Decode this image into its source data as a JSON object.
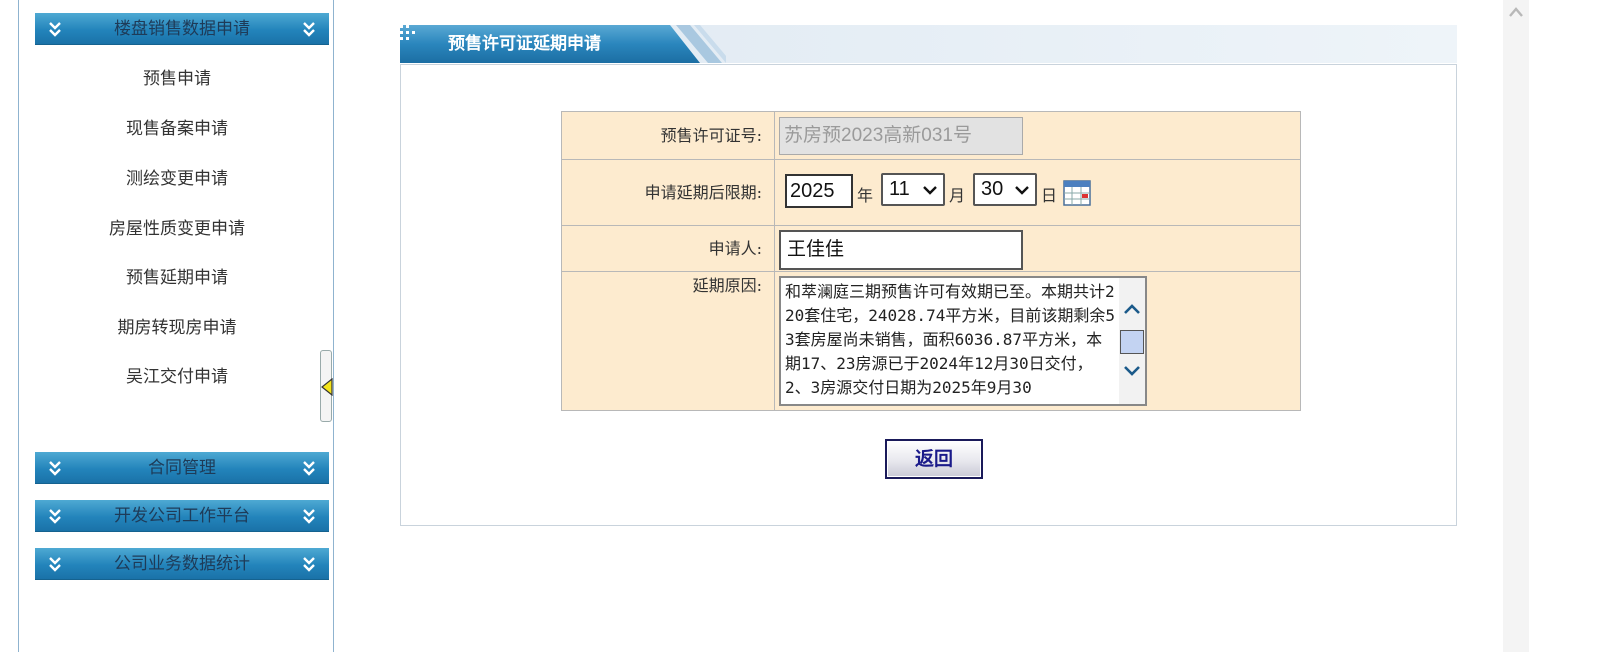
{
  "sidebar": {
    "groups": [
      {
        "title": "楼盘销售数据申请"
      },
      {
        "title": "合同管理"
      },
      {
        "title": "开发公司工作平台"
      },
      {
        "title": "公司业务数据统计"
      }
    ],
    "items": [
      {
        "label": "预售申请"
      },
      {
        "label": "现售备案申请"
      },
      {
        "label": "测绘变更申请"
      },
      {
        "label": "房屋性质变更申请"
      },
      {
        "label": "预售延期申请"
      },
      {
        "label": "期房转现房申请"
      },
      {
        "label": "吴江交付申请"
      }
    ]
  },
  "panel": {
    "title": "预售许可证延期申请"
  },
  "form": {
    "permit_label": "预售许可证号:",
    "permit_value": "苏房预2023高新031号",
    "deadline_label": "申请延期后限期:",
    "year_value": "2025",
    "year_unit": "年",
    "month_value": "11",
    "month_unit": "月",
    "day_value": "30",
    "day_unit": "日",
    "applicant_label": "申请人:",
    "applicant_value": "王佳佳",
    "reason_label": "延期原因:",
    "reason_value": "和萃澜庭三期预售许可有效期已至。本期共计220套住宅，24028.74平方米，目前该期剩余53套房屋尚未销售，面积6036.87平方米，本期17、23房源已于2024年12月30日交付，2、3房源交付日期为2025年9月30"
  },
  "actions": {
    "back_label": "返回"
  },
  "colors": {
    "header_blue": "#2384bb",
    "form_bg": "#fdebcf",
    "scroll_thumb": "#c3d3f2"
  }
}
